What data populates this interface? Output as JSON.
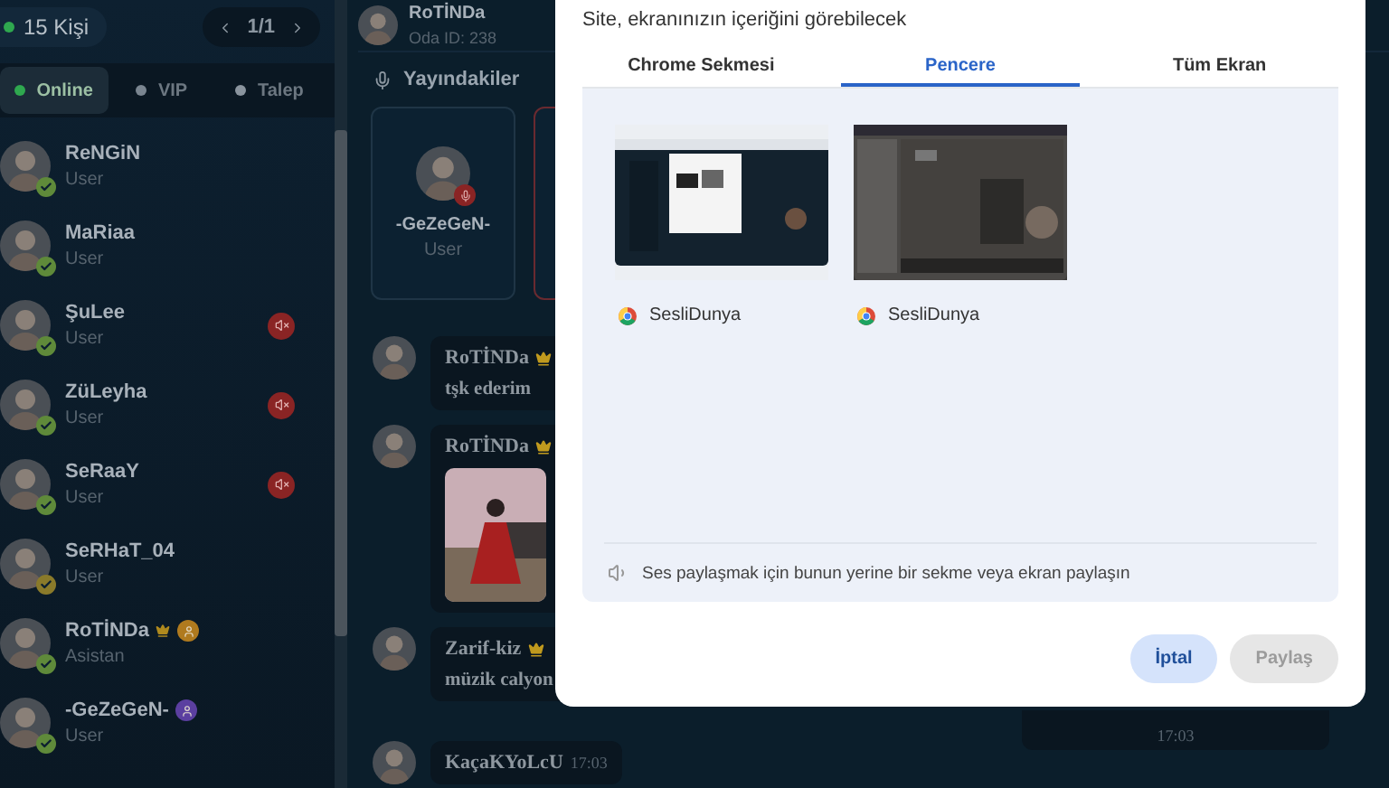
{
  "sidebar": {
    "count": "15 Kişi",
    "page": "1/1",
    "tabs": [
      {
        "label": "Online",
        "selected": true,
        "color": "#2fa84f"
      },
      {
        "label": "VIP",
        "selected": false,
        "color": "#7a8590"
      },
      {
        "label": "Talep",
        "selected": false,
        "color": "#8a949e"
      }
    ],
    "users": [
      {
        "name": "ReNGiN",
        "role": "User",
        "color": "#5f8a3a",
        "muted": false,
        "crown": false
      },
      {
        "name": "MaRiaa",
        "role": "User",
        "color": "#5f8a3a",
        "muted": false,
        "crown": false
      },
      {
        "name": "ŞuLee",
        "role": "User",
        "color": "#5f8a3a",
        "muted": true,
        "crown": false
      },
      {
        "name": "ZüLeyha",
        "role": "User",
        "color": "#5f8a3a",
        "muted": true,
        "crown": false
      },
      {
        "name": "SeRaaY",
        "role": "User",
        "color": "#5f8a3a",
        "muted": true,
        "crown": false
      },
      {
        "name": "SeRHaT_04",
        "role": "User",
        "color": "#8a7a2a",
        "muted": false,
        "crown": false
      },
      {
        "name": "RoTİNDa",
        "role": "Asistan",
        "color": "#5f8a3a",
        "muted": false,
        "crown": true,
        "badge": {
          "color": "#b07a1e"
        }
      },
      {
        "name": "-GeZeGeN-",
        "role": "User",
        "color": "#5f8a3a",
        "muted": false,
        "crown": false,
        "badge": {
          "color": "#5b3fa0"
        }
      }
    ]
  },
  "room": {
    "owner": "RoTİNDa",
    "room_id": "Oda ID: 238"
  },
  "on_air": {
    "title": "Yayındakiler",
    "cards": [
      {
        "name": "-GeZeGeN-",
        "role": "User",
        "highlighted": false
      },
      {
        "highlighted": true
      }
    ]
  },
  "messages": [
    {
      "kind": "text",
      "name": "RoTİNDa",
      "crown": true,
      "text": "tşk ederim"
    },
    {
      "name": "RoTİNDa",
      "crown": true
    },
    {
      "kind": "text",
      "name": "Zarif-kiz",
      "crown": true,
      "text": "müzik calyon"
    },
    {
      "kind": "time",
      "name": "KaçaKYoLcU",
      "crown": false,
      "time": "17:03"
    }
  ],
  "notice": {
    "time": "17:03"
  },
  "dialog": {
    "subtitle": "Site, ekranınızın içeriğini görebilecek",
    "tabs": [
      {
        "label": "Chrome Sekmesi",
        "selected": false
      },
      {
        "label": "Pencere",
        "selected": true
      },
      {
        "label": "Tüm Ekran",
        "selected": false
      }
    ],
    "windows": [
      {
        "title": "SesliDunya",
        "selected": false
      },
      {
        "title": "SesliDunya",
        "selected": false
      }
    ],
    "audio_note": "Ses paylaşmak için bunun yerine bir sekme veya ekran paylaşın",
    "buttons": [
      {
        "label": "İptal",
        "disabled": false
      },
      {
        "label": "Paylaş",
        "disabled": true
      }
    ]
  }
}
